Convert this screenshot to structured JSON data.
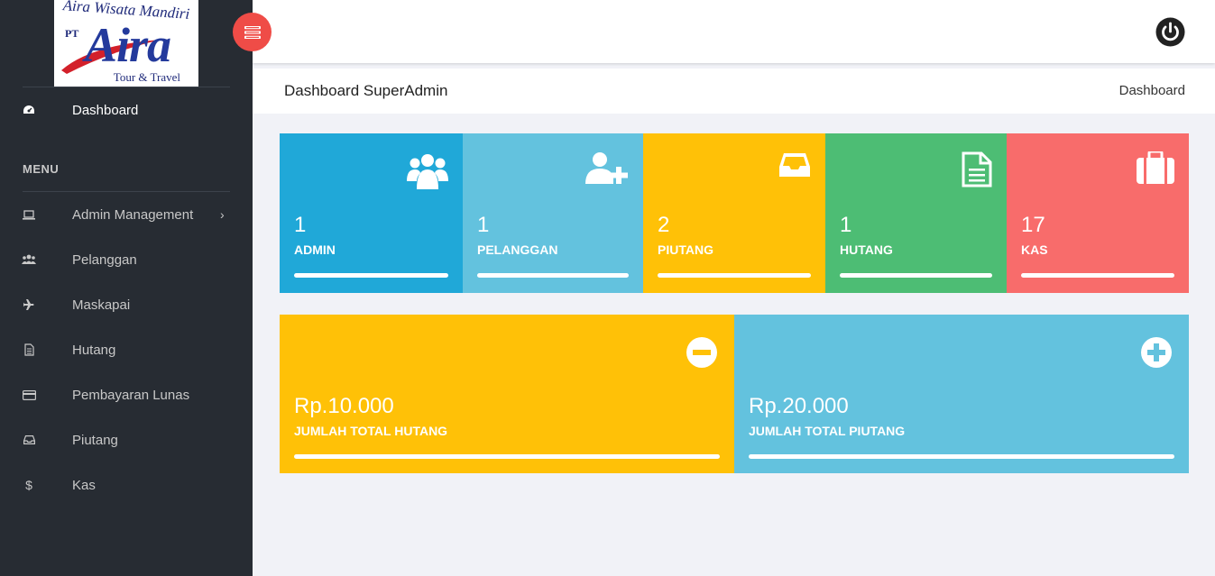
{
  "brand": {
    "arc_text": "Aira Wisata Mandiri",
    "pt_text": "PT",
    "name": "Aira",
    "tagline": "Tour & Travel"
  },
  "sidebar": {
    "dashboard_label": "Dashboard",
    "menu_title": "MENU",
    "items": [
      {
        "label": "Admin Management",
        "icon": "laptop-icon",
        "has_submenu": true
      },
      {
        "label": "Pelanggan",
        "icon": "users-icon"
      },
      {
        "label": "Maskapai",
        "icon": "plane-icon"
      },
      {
        "label": "Hutang",
        "icon": "document-icon"
      },
      {
        "label": "Pembayaran Lunas",
        "icon": "credit-card-icon"
      },
      {
        "label": "Piutang",
        "icon": "inbox-icon"
      },
      {
        "label": "Kas",
        "icon": "dollar-icon",
        "glyph": "$"
      }
    ]
  },
  "header": {
    "toggle_icon": "menu-toggle-icon",
    "power_icon": "power-icon"
  },
  "page": {
    "title": "Dashboard SuperAdmin",
    "breadcrumb": "Dashboard"
  },
  "stats": [
    {
      "value": "1",
      "label": "ADMIN",
      "color": "#20a8d8",
      "icon": "users-icon"
    },
    {
      "value": "1",
      "label": "PELANGGAN",
      "color": "#63c2de",
      "icon": "user-plus-icon"
    },
    {
      "value": "2",
      "label": "PIUTANG",
      "color": "#ffc107",
      "icon": "inbox-icon"
    },
    {
      "value": "1",
      "label": "HUTANG",
      "color": "#4dbd74",
      "icon": "document-icon"
    },
    {
      "value": "17",
      "label": "KAS",
      "color": "#f86c6b",
      "icon": "briefcase-icon"
    }
  ],
  "totals": [
    {
      "value": "Rp.10.000",
      "label": "JUMLAH TOTAL HUTANG",
      "color": "#ffc107",
      "icon": "minus-circle-icon"
    },
    {
      "value": "Rp.20.000",
      "label": "JUMLAH TOTAL PIUTANG",
      "color": "#63c2de",
      "icon": "plus-circle-icon"
    }
  ]
}
